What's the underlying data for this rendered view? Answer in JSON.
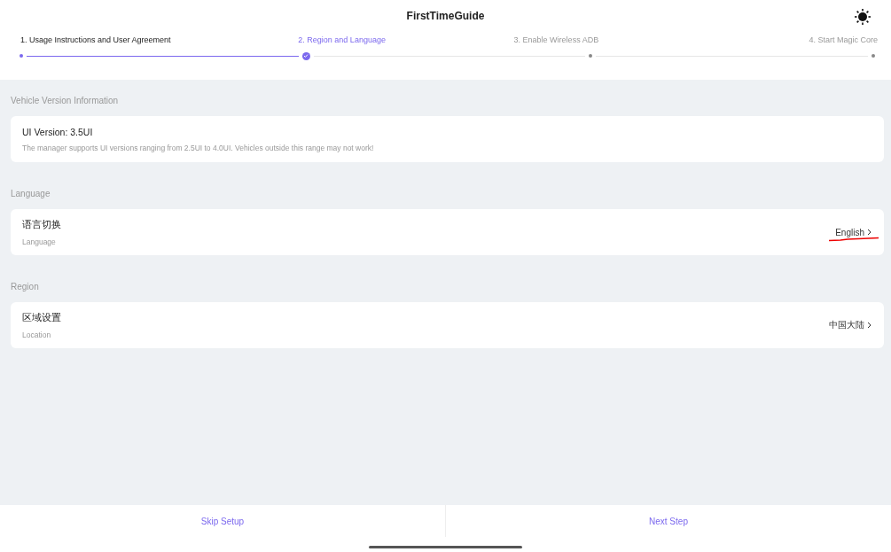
{
  "window": {
    "title": "FirstTimeGuide"
  },
  "steps": [
    {
      "label": "1. Usage Instructions and User Agreement",
      "completed": true,
      "selected": false
    },
    {
      "label": "2. Region and Language",
      "completed": false,
      "selected": true
    },
    {
      "label": "3. Enable Wireless ADB",
      "completed": false,
      "selected": false
    },
    {
      "label": "4. Start Magic Core",
      "completed": false,
      "selected": false
    }
  ],
  "sections": [
    {
      "heading": "Vehicle Version Information",
      "kind": "info",
      "title": "UI Version: 3.5UI",
      "description": "The manager supports UI versions ranging from 2.5UI to 4.0UI. Vehicles outside this range may not work!"
    },
    {
      "heading": "Language",
      "kind": "setting",
      "title": "语言切换",
      "subtitle": "Language",
      "value": "English",
      "annotated": true
    },
    {
      "heading": "Region",
      "kind": "setting",
      "title": "区域设置",
      "subtitle": "Location",
      "value": "中国大陆",
      "annotated": false
    }
  ],
  "buttons": [
    "Skip Setup",
    "Next Step"
  ]
}
